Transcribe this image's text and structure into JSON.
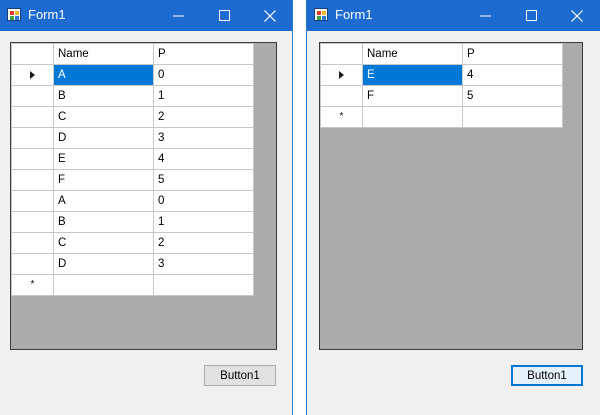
{
  "windows": [
    {
      "title": "Form1",
      "grid": {
        "columns": [
          "Name",
          "P"
        ],
        "rows": [
          {
            "name": "A",
            "p": "0"
          },
          {
            "name": "B",
            "p": "1"
          },
          {
            "name": "C",
            "p": "2"
          },
          {
            "name": "D",
            "p": "3"
          },
          {
            "name": "E",
            "p": "4"
          },
          {
            "name": "F",
            "p": "5"
          },
          {
            "name": "A",
            "p": "0"
          },
          {
            "name": "B",
            "p": "1"
          },
          {
            "name": "C",
            "p": "2"
          },
          {
            "name": "D",
            "p": "3"
          }
        ],
        "new_row_marker": "*",
        "current_row_icon": "row-pointer-icon"
      },
      "button_label": "Button1"
    },
    {
      "title": "Form1",
      "grid": {
        "columns": [
          "Name",
          "P"
        ],
        "rows": [
          {
            "name": "E",
            "p": "4"
          },
          {
            "name": "F",
            "p": "5"
          }
        ],
        "new_row_marker": "*",
        "current_row_icon": "row-pointer-icon"
      },
      "button_label": "Button1"
    }
  ],
  "colors": {
    "titlebar": "#1d6ad1",
    "selection": "#0078d7",
    "grid_background": "#ababab"
  }
}
